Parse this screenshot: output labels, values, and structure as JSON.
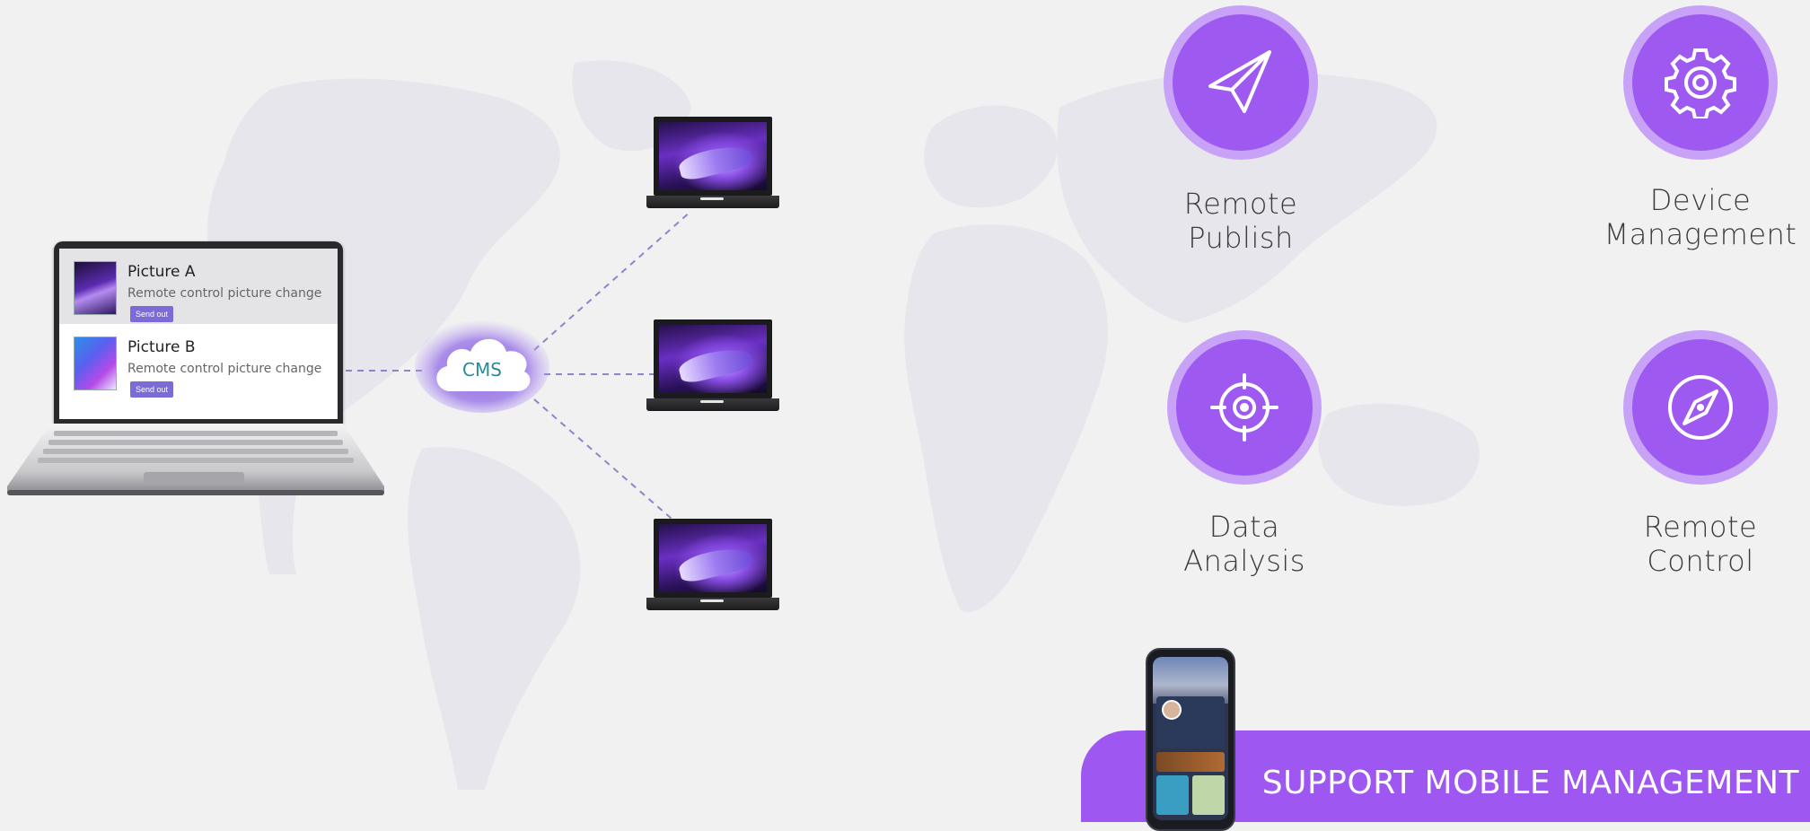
{
  "laptop_panel": {
    "items": [
      {
        "title": "Picture A",
        "description": "Remote control picture change",
        "button": "Send out"
      },
      {
        "title": "Picture B",
        "description": "Remote control picture change",
        "button": "Send out"
      }
    ]
  },
  "cloud": {
    "label": "CMS"
  },
  "features": [
    {
      "line1": "Remote",
      "line2": "Publish",
      "icon": "paper-plane-icon"
    },
    {
      "line1": "Device",
      "line2": "Management",
      "icon": "gear-icon"
    },
    {
      "line1": "Data",
      "line2": "Analysis",
      "icon": "target-icon"
    },
    {
      "line1": "Remote",
      "line2": "Control",
      "icon": "compass-icon"
    }
  ],
  "banner": {
    "text": "SUPPORT MOBILE MANAGEMENT"
  },
  "colors": {
    "accent": "#9d59f0",
    "accent_light": "#c8a2f7",
    "button": "#7b6bd8",
    "background": "#f1f1f1"
  }
}
